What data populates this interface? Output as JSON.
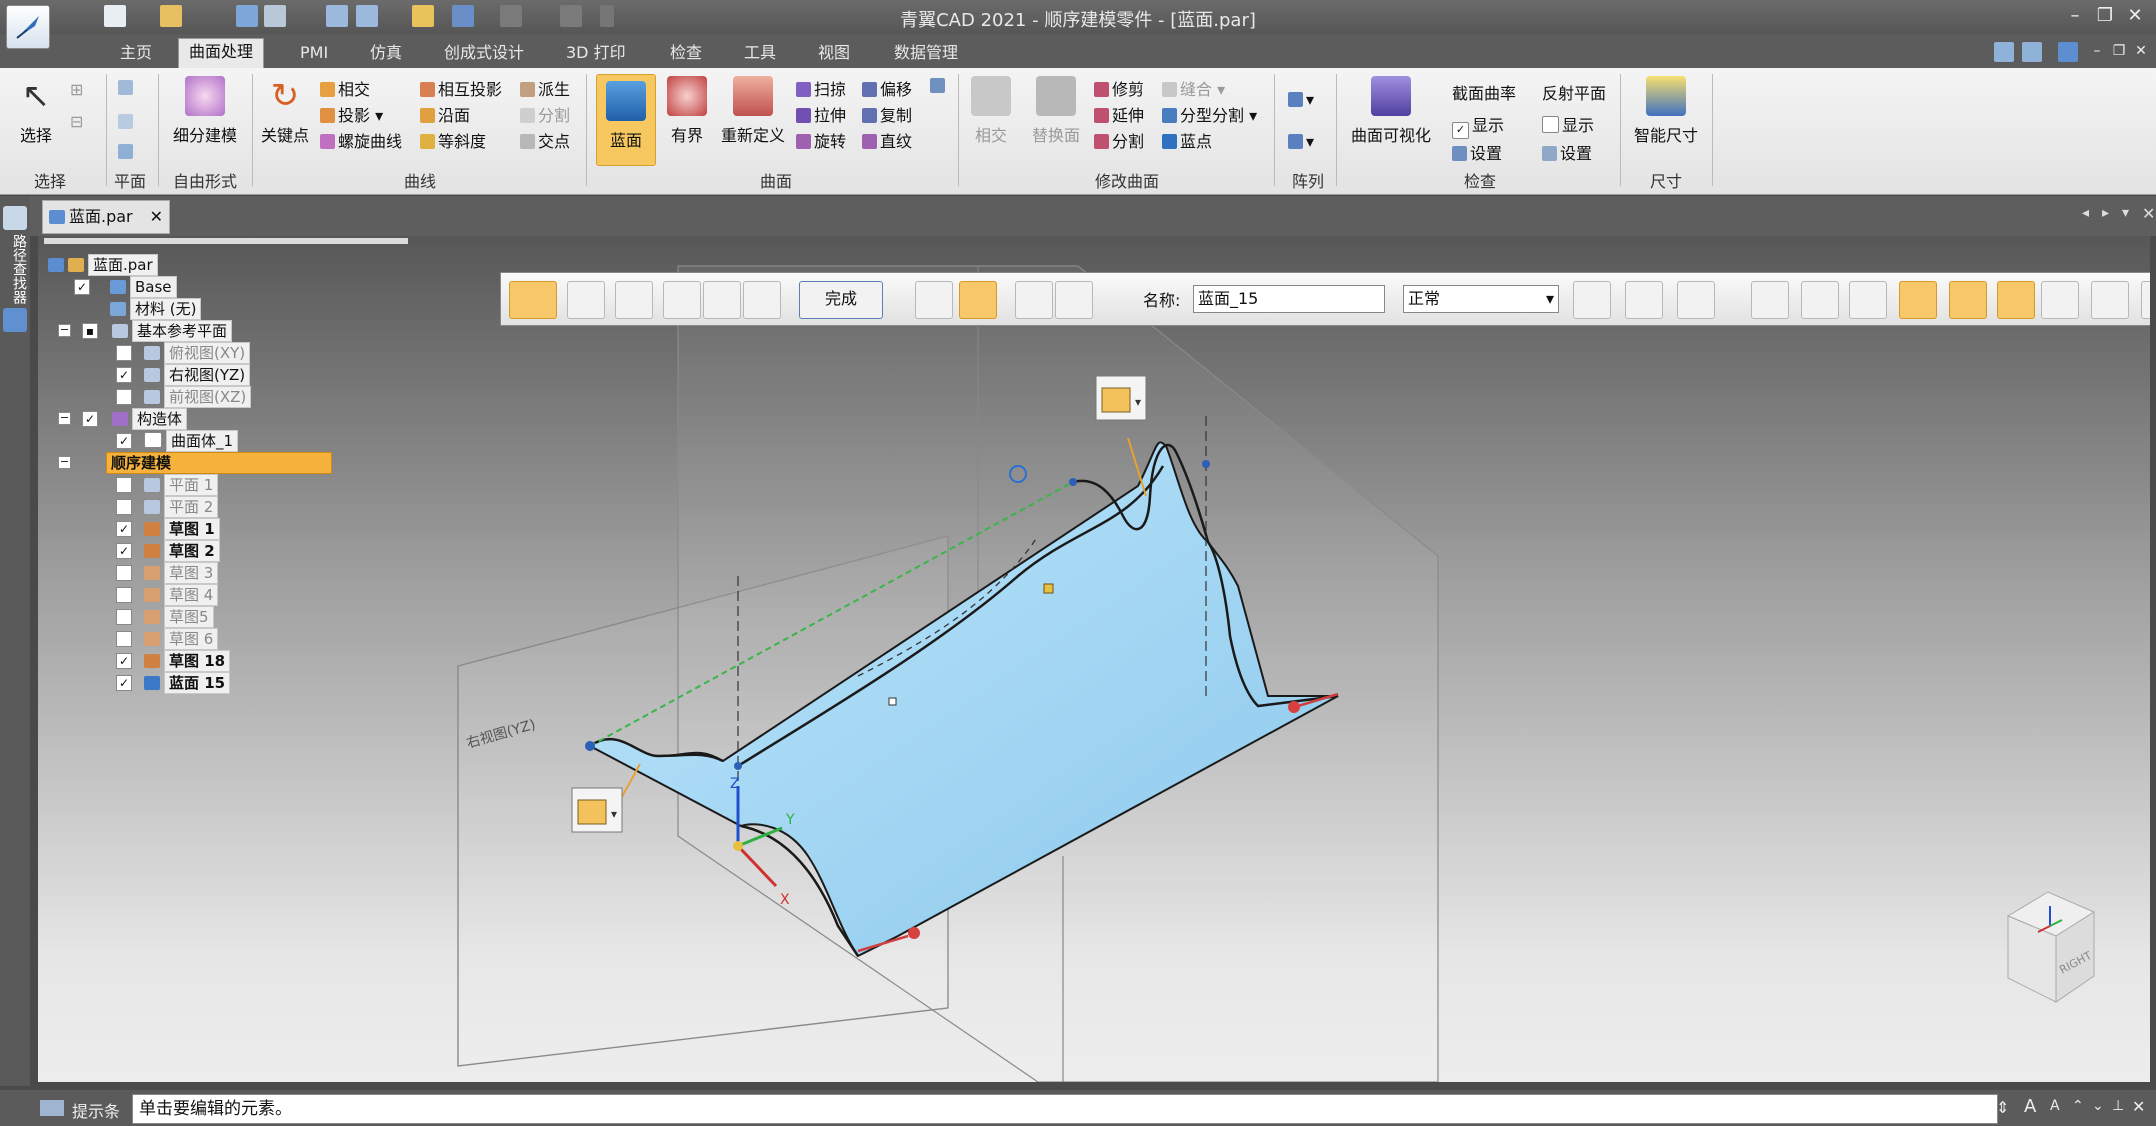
{
  "window": {
    "title": "青翼CAD 2021 - 顺序建模零件 - [蓝面.par]"
  },
  "menu": {
    "tabs": [
      "主页",
      "曲面处理",
      "PMI",
      "仿真",
      "创成式设计",
      "3D 打印",
      "检查",
      "工具",
      "视图",
      "数据管理"
    ],
    "active_index": 1
  },
  "ribbon": {
    "select": {
      "label": "选择",
      "group": "选择"
    },
    "plane_group": "平面",
    "freeform": {
      "label": "细分建模",
      "group": "自由形式"
    },
    "curves": {
      "keypoint": "关键点",
      "intersect": "相交",
      "project": "投影",
      "helix": "螺旋曲线",
      "cross_project": "相互投影",
      "along": "沿面",
      "isocline": "等斜度",
      "derive": "派生",
      "split": "分割",
      "intersection_point": "交点",
      "group": "曲线"
    },
    "surfaces": {
      "bluesurf": "蓝面",
      "bounded": "有界",
      "redefine": "重新定义",
      "sweep": "扫掠",
      "extrude": "拉伸",
      "revolve": "旋转",
      "offset": "偏移",
      "copy": "复制",
      "ruled": "直纹",
      "group": "曲面"
    },
    "modify": {
      "intersect": "相交",
      "replace": "替换面",
      "trim": "修剪",
      "extend": "延伸",
      "split": "分割",
      "stitch": "缝合",
      "parting_split": "分型分割",
      "bluedot": "蓝点",
      "group": "修改曲面"
    },
    "array": {
      "group": "阵列"
    },
    "inspect": {
      "vis": "曲面可视化",
      "curvature": "截面曲率",
      "show1": "显示",
      "settings1": "设置",
      "reflect": "反射平面",
      "show2": "显示",
      "settings2": "设置",
      "group": "检查"
    },
    "dimension": {
      "smart": "智能尺寸",
      "group": "尺寸"
    }
  },
  "leftstrip": {
    "label": "路径查找器"
  },
  "document_tab": {
    "label": "蓝面.par"
  },
  "tree": [
    {
      "label": "蓝面.par"
    },
    {
      "label": "Base"
    },
    {
      "label": "材料 (无)"
    },
    {
      "label": "基本参考平面"
    },
    {
      "label": "俯视图(XY)"
    },
    {
      "label": "右视图(YZ)"
    },
    {
      "label": "前视图(XZ)"
    },
    {
      "label": "构造体"
    },
    {
      "label": "曲面体_1"
    },
    {
      "label": "顺序建模"
    },
    {
      "label": "平面 1"
    },
    {
      "label": "平面 2"
    },
    {
      "label": "草图 1"
    },
    {
      "label": "草图 2"
    },
    {
      "label": "草图 3"
    },
    {
      "label": "草图 4"
    },
    {
      "label": "草图5"
    },
    {
      "label": "草图 6"
    },
    {
      "label": "草图 18"
    },
    {
      "label": "蓝面 15"
    }
  ],
  "cmdbar": {
    "finish": "完成",
    "name_label": "名称:",
    "name_value": "蓝面_15",
    "mode_value": "正常"
  },
  "scene": {
    "plane_label": "右视图(YZ)",
    "axis_x": "X",
    "axis_y": "Y",
    "axis_z": "Z",
    "viewcube_label": "RIGHT",
    "surface_color": "#a9d9f3",
    "edge_color": "#1a1a1a",
    "handle_color": "#e8c040",
    "endpoint_color": "#d84040"
  },
  "statusbar": {
    "prompt_label": "提示条",
    "prompt_text": "单击要编辑的元素。"
  }
}
